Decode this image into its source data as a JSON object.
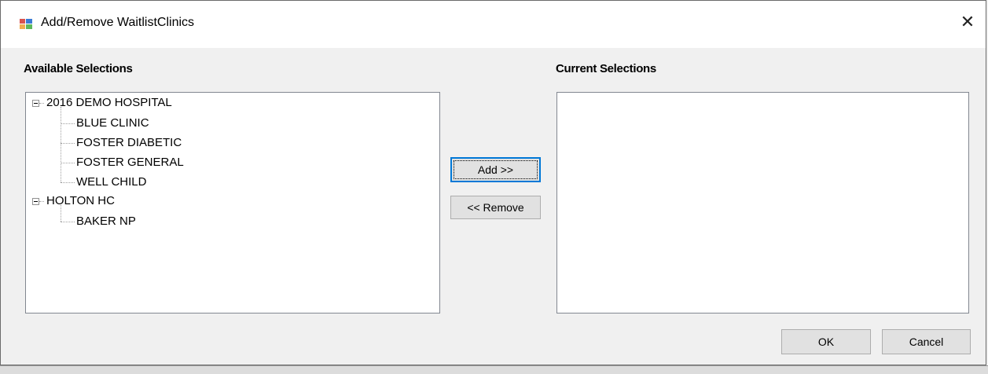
{
  "window": {
    "title": "Add/Remove WaitlistClinics",
    "close_glyph": "✕"
  },
  "labels": {
    "available": "Available Selections",
    "current": "Current Selections"
  },
  "tree": [
    {
      "label": "2016 DEMO HOSPITAL",
      "children": [
        "BLUE CLINIC",
        "FOSTER DIABETIC",
        "FOSTER GENERAL",
        "WELL CHILD"
      ]
    },
    {
      "label": "HOLTON HC",
      "children": [
        "BAKER NP"
      ]
    }
  ],
  "buttons": {
    "add": "Add >>",
    "remove": "<< Remove",
    "ok": "OK",
    "cancel": "Cancel"
  },
  "colors": {
    "accent": "#0078d7",
    "window_bg": "#f0f0f0"
  },
  "icons": {
    "app": "app-window-icon",
    "close": "close-icon",
    "expander": "tree-collapse-icon"
  }
}
